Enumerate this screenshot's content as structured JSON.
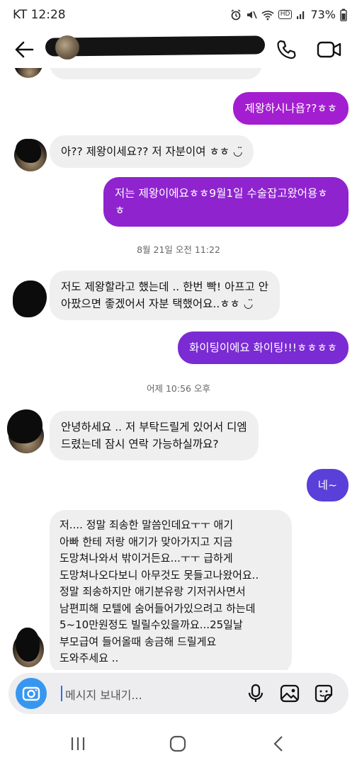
{
  "status_bar": {
    "carrier_time": "KT 12:28",
    "battery": "73%",
    "icons": [
      "alarm-icon",
      "mute-icon",
      "wifi-icon",
      "hd-icon",
      "signal-icon",
      "battery-icon"
    ],
    "hd_label": "HD"
  },
  "header": {
    "icons": [
      "back-arrow-icon",
      "phone-icon",
      "video-icon"
    ]
  },
  "messages": [
    {
      "side": "out",
      "text": "제왕하시나욥??ㅎㅎ"
    },
    {
      "side": "in",
      "text": "아?? 제왕이세요?? 저 자분이여 ㅎㅎ ◡̈"
    },
    {
      "side": "out",
      "text": "저는 제왕이에요ㅎㅎ9월1일 수술잡고왔어용ㅎ\nㅎ"
    },
    {
      "side": "stamp",
      "text": "8월 21일 오전 11:22"
    },
    {
      "side": "in",
      "text": "저도 제왕할라고 했는데 .. 한번 빡! 아프고 안\n아팠으면 좋겠어서 자분 택했어요..ㅎㅎ ◡̈"
    },
    {
      "side": "out",
      "text": "화이팅이에요 화이팅!!!ㅎㅎㅎㅎ"
    },
    {
      "side": "stamp",
      "text": "어제 10:56 오후"
    },
    {
      "side": "in",
      "text": "안녕하세요 .. 저 부탁드릴게 있어서 디엠\n드렸는데 잠시 연락 가능하실까요?"
    },
    {
      "side": "out",
      "text": "네~"
    },
    {
      "side": "in",
      "text": "저.... 정말 죄송한 말씀인데요ㅜㅜ 애기\n아빠 한테  저랑 애기가 맞아가지고 지금\n도망쳐나와서 밖이거든요...ㅜㅜ 급하게\n도망쳐나오다보니 아무것도 못들고나왔어요..\n정말 죄송하지만 애기분유랑 기저귀사면서\n남편피해 모텔에 숨어들어가있으려고 하는데\n5~10만원정도 빌릴수있을까요...25일날\n부모급여 들어올때 송금해 드릴게요\n도와주세요 .."
    }
  ],
  "input": {
    "placeholder": "메시지 보내기...",
    "icons": [
      "camera-icon",
      "microphone-icon",
      "gallery-icon",
      "sticker-icon"
    ]
  },
  "nav": {
    "icons": [
      "recent-apps-icon",
      "home-icon",
      "back-icon"
    ]
  },
  "colors": {
    "outgoing_top": "#a31ed0",
    "outgoing_bottom": "#5a3fd8",
    "incoming": "#efeff0",
    "camera": "#3797f0"
  }
}
